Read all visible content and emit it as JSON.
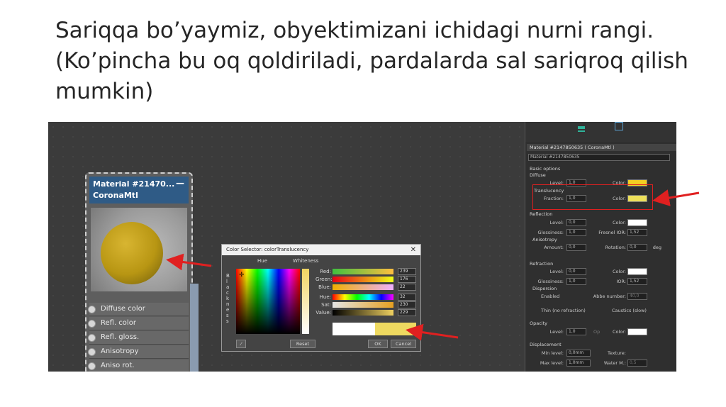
{
  "slide": {
    "title": "Sariqqa bo’yaymiz, obyektimizani ichidagi nurni rangi.(Ko’pincha bu oq qoldiriladi, pardalarda sal sariqroq qilish mumkin)"
  },
  "node": {
    "title_line1": "Material #21470...",
    "title_line2": "CoronaMtl",
    "min_glyph": "—",
    "slots": [
      "Diffuse color",
      "Refl. color",
      "Refl. gloss.",
      "Anisotropy",
      "Aniso rot."
    ]
  },
  "dialog": {
    "title": "Color Selector: colorTranslucency",
    "close_glyph": "✕",
    "hue_label": "Hue",
    "whiteness_label": "Whiteness",
    "blackness_label": "B l a c k n e s s",
    "rows": [
      {
        "label": "Red:",
        "value": "239"
      },
      {
        "label": "Green:",
        "value": "176"
      },
      {
        "label": "Blue:",
        "value": "22"
      },
      {
        "label": "Hue:",
        "value": "32"
      },
      {
        "label": "Sat:",
        "value": "230"
      },
      {
        "label": "Value:",
        "value": "229"
      }
    ],
    "reset_label": "Reset",
    "ok_label": "OK",
    "cancel_label": "Cancel",
    "colors": {
      "swatch_original": "#ffffff",
      "swatch_new": "#eed960"
    }
  },
  "panel": {
    "header": "Material #2147850635  ( CoronaMtl )",
    "name_field": "Material #2147850635",
    "basic_options": "Basic options",
    "diffuse": "Diffuse",
    "level_label": "Level:",
    "level_value": "1,0",
    "color_label": "Color:",
    "translucency": "Translucency",
    "fraction_label": "Fraction:",
    "fraction_value": "1,0",
    "reflection": "Reflection",
    "refl_level": "0,0",
    "glossiness_label": "Glossiness:",
    "refl_gloss": "1,0",
    "fresnel_label": "Fresnel IOR:",
    "fresnel_value": "1,52",
    "anisotropy": "Anisotropy",
    "amount_label": "Amount:",
    "amount_value": "0,0",
    "rotation_label": "Rotation:",
    "rotation_value": "0,0",
    "deg": "deg",
    "refraction": "Refraction",
    "refr_level": "0,0",
    "refr_gloss": "1,0",
    "ior_label": "IOR:",
    "ior_value": "1,52",
    "dispersion": "Dispersion",
    "enabled": "Enabled",
    "abbe_label": "Abbe number:",
    "abbe_value": "40,0",
    "thin": "Thin (no refraction)",
    "caustics": "Caustics (slow)",
    "opacity": "Opacity",
    "op_level": "1,0",
    "op_label": "Op",
    "displacement": "Displacement",
    "min_level_label": "Min level:",
    "min_level_value": "0,0mm",
    "texture_label": "Texture:",
    "max_level_label": "Max level:",
    "max_level_value": "1,0mm",
    "water_label": "Water M.:",
    "water_value": "0,5",
    "colors": {
      "diffuse": "#f2d023",
      "translucency": "#ede05a",
      "white": "#ffffff"
    }
  },
  "annotations": {
    "arrow_color": "#e02020"
  }
}
